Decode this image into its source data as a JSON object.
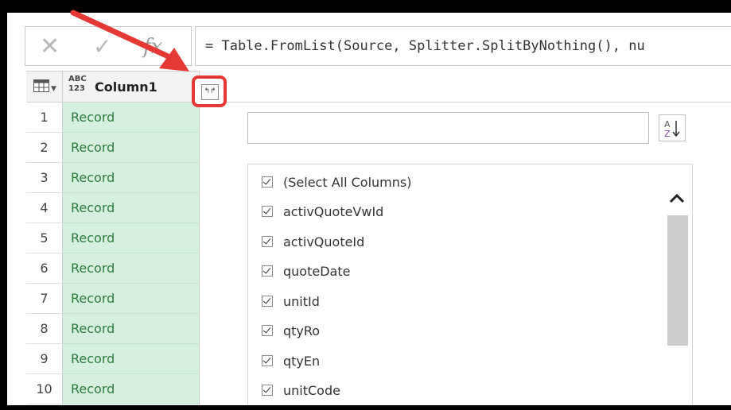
{
  "formula_bar": {
    "cancel_glyph": "✕",
    "confirm_glyph": "✓",
    "fx_label": "fx",
    "formula": "= Table.FromList(Source, Splitter.SplitByNothing(), nu"
  },
  "grid": {
    "column_type": "ABC\n123",
    "column_name": "Column1",
    "rows": [
      {
        "num": "1",
        "value": "Record"
      },
      {
        "num": "2",
        "value": "Record"
      },
      {
        "num": "3",
        "value": "Record"
      },
      {
        "num": "4",
        "value": "Record"
      },
      {
        "num": "5",
        "value": "Record"
      },
      {
        "num": "6",
        "value": "Record"
      },
      {
        "num": "7",
        "value": "Record"
      },
      {
        "num": "8",
        "value": "Record"
      },
      {
        "num": "9",
        "value": "Record"
      },
      {
        "num": "10",
        "value": "Record"
      }
    ]
  },
  "expand_panel": {
    "search_value": "",
    "columns": [
      {
        "label": "(Select All Columns)",
        "checked": true
      },
      {
        "label": "activQuoteVwId",
        "checked": true
      },
      {
        "label": "activQuoteId",
        "checked": true
      },
      {
        "label": "quoteDate",
        "checked": true
      },
      {
        "label": "unitId",
        "checked": true
      },
      {
        "label": "qtyRo",
        "checked": true
      },
      {
        "label": "qtyEn",
        "checked": true
      },
      {
        "label": "unitCode",
        "checked": true
      }
    ]
  },
  "colors": {
    "highlight": "#e53935",
    "cell_bg": "#d6f0e0",
    "cell_text": "#2f7a3e"
  }
}
